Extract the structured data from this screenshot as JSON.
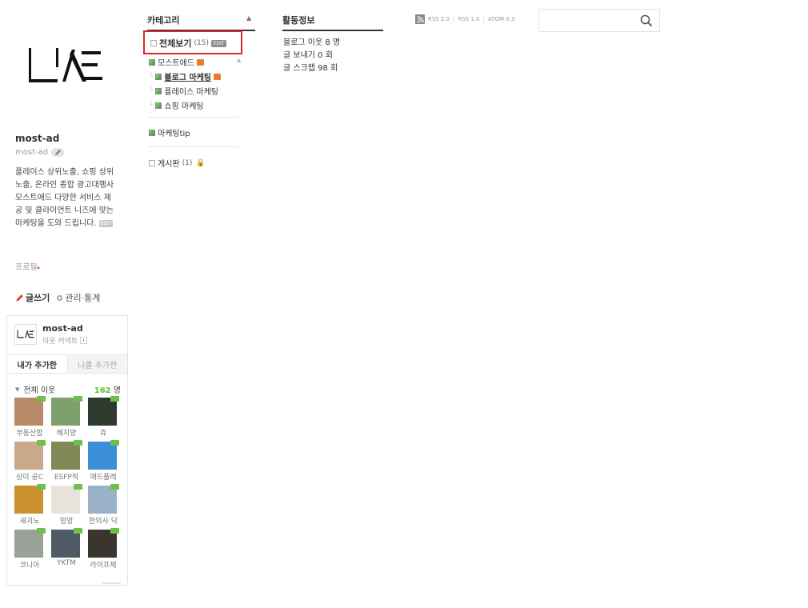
{
  "profile": {
    "blog_name": "most-ad",
    "blog_id": "most-ad",
    "description": "플레이스 상위노출, 쇼핑 상위노출, 온라인 종합 광고대행사 모스트애드 다양한 서비스 제공 및 클라이언트 니즈에 맞는 마케팅을 도와 드립니다.",
    "edit_tag": "EDIT",
    "profile_link": "프로필",
    "write_label": "글쓰기",
    "manage_label": "관리·통계",
    "icons": {
      "logo": "blog-logo",
      "edit": "pencil-icon",
      "write": "pencil-icon",
      "manage": "gear-icon"
    }
  },
  "neighbors": {
    "name": "most-ad",
    "sub_label": "이웃 커넥트",
    "tabs": [
      "내가 추가한",
      "나를 추가한"
    ],
    "all_label": "전체 이웃",
    "count": "162",
    "count_unit": "명",
    "count_color": "#5bbf3c",
    "items": [
      {
        "label": "부동산합",
        "color": "#b98a6a",
        "new": true
      },
      {
        "label": "혜지양",
        "color": "#7ea06e",
        "new": true
      },
      {
        "label": "쥬",
        "color": "#2d3a2e",
        "new": true
      },
      {
        "label": "삼이 공C",
        "color": "#c9a98c",
        "new": true
      },
      {
        "label": "ESFP적",
        "color": "#7f8a57",
        "new": true
      },
      {
        "label": "애드플레",
        "color": "#3a8fd6",
        "new": true
      },
      {
        "label": "새괴노",
        "color": "#c9922f",
        "new": true
      },
      {
        "label": "멍멍",
        "color": "#e8e4dc",
        "new": true
      },
      {
        "label": "한의사 닥",
        "color": "#9bb1c7",
        "new": true
      },
      {
        "label": "코니아",
        "color": "#9aa196",
        "new": true
      },
      {
        "label": "YKTM",
        "color": "#4f5a64",
        "new": true
      },
      {
        "label": "라이프체",
        "color": "#3b352f",
        "new": true
      }
    ]
  },
  "category": {
    "title": "카테고리",
    "toggle_icon": "chevron-up-icon",
    "all_label": "전체보기",
    "all_count": "(15)",
    "all_edit": "EDIT",
    "items": [
      {
        "label": "모스트애드",
        "indent": false,
        "new": true,
        "highlight": false
      },
      {
        "label": "블로그 마케팅",
        "indent": true,
        "new": true,
        "highlight": true
      },
      {
        "label": "플레이스 마케팅",
        "indent": true,
        "new": false,
        "highlight": false
      },
      {
        "label": "쇼핑 마케팅",
        "indent": true,
        "new": false,
        "highlight": false
      }
    ],
    "tip_label": "마케팅tip",
    "board_label": "게시판",
    "board_count": "(1)",
    "highlight_color": "#d9282a",
    "new_color": "#f07a2c"
  },
  "activity": {
    "title": "활동정보",
    "lines": [
      "블로그 이웃 8 명",
      "글 보내기 0 회",
      "글 스크랩 98 회"
    ]
  },
  "rss": {
    "icon": "rss-icon",
    "links": [
      "RSS 2.0",
      "RSS 1.0",
      "ATOM 0.3"
    ]
  },
  "search": {
    "value": "",
    "placeholder": "",
    "icon": "search-icon"
  }
}
